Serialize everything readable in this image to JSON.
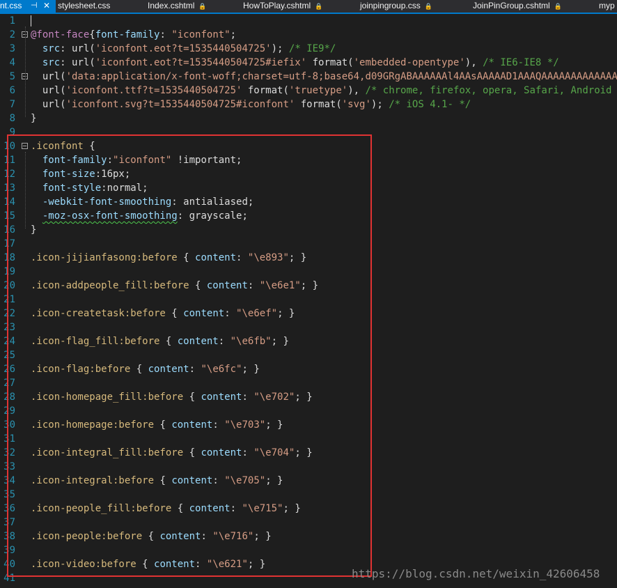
{
  "tabs": [
    {
      "label": "nt.css",
      "active": true
    },
    {
      "label": "stylesheet.css",
      "active": false
    },
    {
      "label": "Index.cshtml",
      "active": false
    },
    {
      "label": "HowToPlay.cshtml",
      "active": false
    },
    {
      "label": "joinpingroup.css",
      "active": false
    },
    {
      "label": "JoinPinGroup.cshtml",
      "active": false
    },
    {
      "label": "myp",
      "active": false
    }
  ],
  "active_tab": {
    "pin_glyph": "⊣",
    "close_glyph": "✕"
  },
  "pin_glyph": "🔒",
  "lines": [
    {
      "n": "1",
      "parts": []
    },
    {
      "n": "2",
      "fold": true,
      "parts": [
        [
          "at",
          "@font-face"
        ],
        [
          "",
          "{"
        ],
        [
          "prop",
          "font-family"
        ],
        [
          "",
          ": "
        ],
        [
          "str",
          "\"iconfont\""
        ],
        [
          "",
          ";"
        ]
      ]
    },
    {
      "n": "3",
      "parts": [
        [
          "",
          "  "
        ],
        [
          "prop",
          "src"
        ],
        [
          "",
          ": url("
        ],
        [
          "str",
          "'iconfont.eot?t=1535440504725'"
        ],
        [
          "",
          "); "
        ],
        [
          "cmt",
          "/* IE9*/"
        ]
      ]
    },
    {
      "n": "4",
      "parts": [
        [
          "",
          "  "
        ],
        [
          "prop",
          "src"
        ],
        [
          "",
          ": url("
        ],
        [
          "str",
          "'iconfont.eot?t=1535440504725#iefix'"
        ],
        [
          "",
          " format("
        ],
        [
          "str",
          "'embedded-opentype'"
        ],
        [
          "",
          "), "
        ],
        [
          "cmt",
          "/* IE6-IE8 */"
        ]
      ]
    },
    {
      "n": "5",
      "fold": true,
      "parts": [
        [
          "",
          "  url("
        ],
        [
          "str",
          "'data:application/x-font-woff;charset=utf-8;base64,d09GRgABAAAAAAl4AAsAAAAAD1AAAQAAAAAAAAAAAAAA"
        ]
      ]
    },
    {
      "n": "6",
      "parts": [
        [
          "",
          "  url("
        ],
        [
          "str",
          "'iconfont.ttf?t=1535440504725'"
        ],
        [
          "",
          " format("
        ],
        [
          "str",
          "'truetype'"
        ],
        [
          "",
          "), "
        ],
        [
          "cmt",
          "/* chrome, firefox, opera, Safari, Android"
        ]
      ]
    },
    {
      "n": "7",
      "parts": [
        [
          "",
          "  url("
        ],
        [
          "str",
          "'iconfont.svg?t=1535440504725#iconfont'"
        ],
        [
          "",
          " format("
        ],
        [
          "str",
          "'svg'"
        ],
        [
          "",
          "); "
        ],
        [
          "cmt",
          "/* iOS 4.1- */"
        ]
      ]
    },
    {
      "n": "8",
      "parts": [
        [
          "",
          "}"
        ]
      ]
    },
    {
      "n": "9",
      "parts": []
    },
    {
      "n": "10",
      "fold": true,
      "parts": [
        [
          "sel",
          ".iconfont"
        ],
        [
          "",
          " {"
        ]
      ]
    },
    {
      "n": "11",
      "parts": [
        [
          "",
          "  "
        ],
        [
          "prop",
          "font-family"
        ],
        [
          "",
          ":"
        ],
        [
          "str",
          "\"iconfont\""
        ],
        [
          "",
          " !important;"
        ]
      ]
    },
    {
      "n": "12",
      "parts": [
        [
          "",
          "  "
        ],
        [
          "prop",
          "font-size"
        ],
        [
          "",
          ":16px;"
        ]
      ]
    },
    {
      "n": "13",
      "parts": [
        [
          "",
          "  "
        ],
        [
          "prop",
          "font-style"
        ],
        [
          "",
          ":normal;"
        ]
      ]
    },
    {
      "n": "14",
      "parts": [
        [
          "",
          "  "
        ],
        [
          "prop",
          "-webkit-font-smoothing"
        ],
        [
          "",
          ": antialiased;"
        ]
      ]
    },
    {
      "n": "15",
      "parts": [
        [
          "",
          "  "
        ],
        [
          "prop wavy",
          "-moz-osx-font-smoothing"
        ],
        [
          "",
          ": grayscale;"
        ]
      ]
    },
    {
      "n": "16",
      "parts": [
        [
          "",
          "}"
        ]
      ]
    },
    {
      "n": "17",
      "parts": []
    },
    {
      "n": "18",
      "parts": [
        [
          "sel",
          ".icon-jijianfasong:before"
        ],
        [
          "",
          " { "
        ],
        [
          "prop",
          "content"
        ],
        [
          "",
          ": "
        ],
        [
          "str",
          "\"\\e893\""
        ],
        [
          "",
          "; }"
        ]
      ]
    },
    {
      "n": "19",
      "parts": []
    },
    {
      "n": "20",
      "parts": [
        [
          "sel",
          ".icon-addpeople_fill:before"
        ],
        [
          "",
          " { "
        ],
        [
          "prop",
          "content"
        ],
        [
          "",
          ": "
        ],
        [
          "str",
          "\"\\e6e1\""
        ],
        [
          "",
          "; }"
        ]
      ]
    },
    {
      "n": "21",
      "parts": []
    },
    {
      "n": "22",
      "parts": [
        [
          "sel",
          ".icon-createtask:before"
        ],
        [
          "",
          " { "
        ],
        [
          "prop",
          "content"
        ],
        [
          "",
          ": "
        ],
        [
          "str",
          "\"\\e6ef\""
        ],
        [
          "",
          "; }"
        ]
      ]
    },
    {
      "n": "23",
      "parts": []
    },
    {
      "n": "24",
      "parts": [
        [
          "sel",
          ".icon-flag_fill:before"
        ],
        [
          "",
          " { "
        ],
        [
          "prop",
          "content"
        ],
        [
          "",
          ": "
        ],
        [
          "str",
          "\"\\e6fb\""
        ],
        [
          "",
          "; }"
        ]
      ]
    },
    {
      "n": "25",
      "parts": []
    },
    {
      "n": "26",
      "parts": [
        [
          "sel",
          ".icon-flag:before"
        ],
        [
          "",
          " { "
        ],
        [
          "prop",
          "content"
        ],
        [
          "",
          ": "
        ],
        [
          "str",
          "\"\\e6fc\""
        ],
        [
          "",
          "; }"
        ]
      ]
    },
    {
      "n": "27",
      "parts": []
    },
    {
      "n": "28",
      "parts": [
        [
          "sel",
          ".icon-homepage_fill:before"
        ],
        [
          "",
          " { "
        ],
        [
          "prop",
          "content"
        ],
        [
          "",
          ": "
        ],
        [
          "str",
          "\"\\e702\""
        ],
        [
          "",
          "; }"
        ]
      ]
    },
    {
      "n": "29",
      "parts": []
    },
    {
      "n": "30",
      "parts": [
        [
          "sel",
          ".icon-homepage:before"
        ],
        [
          "",
          " { "
        ],
        [
          "prop",
          "content"
        ],
        [
          "",
          ": "
        ],
        [
          "str",
          "\"\\e703\""
        ],
        [
          "",
          "; }"
        ]
      ]
    },
    {
      "n": "31",
      "parts": []
    },
    {
      "n": "32",
      "parts": [
        [
          "sel",
          ".icon-integral_fill:before"
        ],
        [
          "",
          " { "
        ],
        [
          "prop",
          "content"
        ],
        [
          "",
          ": "
        ],
        [
          "str",
          "\"\\e704\""
        ],
        [
          "",
          "; }"
        ]
      ]
    },
    {
      "n": "33",
      "parts": []
    },
    {
      "n": "34",
      "parts": [
        [
          "sel",
          ".icon-integral:before"
        ],
        [
          "",
          " { "
        ],
        [
          "prop",
          "content"
        ],
        [
          "",
          ": "
        ],
        [
          "str",
          "\"\\e705\""
        ],
        [
          "",
          "; }"
        ]
      ]
    },
    {
      "n": "35",
      "parts": []
    },
    {
      "n": "36",
      "parts": [
        [
          "sel",
          ".icon-people_fill:before"
        ],
        [
          "",
          " { "
        ],
        [
          "prop",
          "content"
        ],
        [
          "",
          ": "
        ],
        [
          "str",
          "\"\\e715\""
        ],
        [
          "",
          "; }"
        ]
      ]
    },
    {
      "n": "37",
      "parts": []
    },
    {
      "n": "38",
      "parts": [
        [
          "sel",
          ".icon-people:before"
        ],
        [
          "",
          " { "
        ],
        [
          "prop",
          "content"
        ],
        [
          "",
          ": "
        ],
        [
          "str",
          "\"\\e716\""
        ],
        [
          "",
          "; }"
        ]
      ]
    },
    {
      "n": "39",
      "parts": []
    },
    {
      "n": "40",
      "parts": [
        [
          "sel",
          ".icon-video:before"
        ],
        [
          "",
          " { "
        ],
        [
          "prop",
          "content"
        ],
        [
          "",
          ": "
        ],
        [
          "str",
          "\"\\e621\""
        ],
        [
          "",
          "; }"
        ]
      ]
    },
    {
      "n": "41",
      "parts": []
    }
  ],
  "watermark": "https://blog.csdn.net/weixin_42606458",
  "colors": {
    "background": "#1e1e1e",
    "accent": "#007acc",
    "highlight_box": "#e03333"
  }
}
